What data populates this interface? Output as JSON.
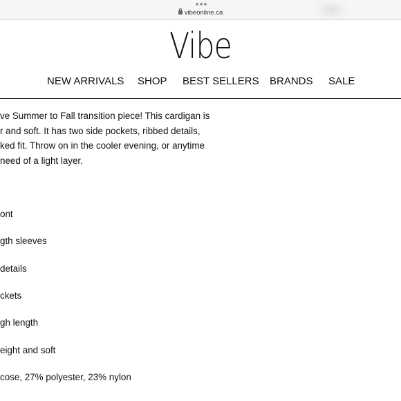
{
  "browser": {
    "url": "vibeonline.ca"
  },
  "brand": {
    "logo_text": "Vibe"
  },
  "nav": {
    "items": [
      {
        "label": "NEW ARRIVALS"
      },
      {
        "label": "SHOP"
      },
      {
        "label": "BEST SELLERS"
      },
      {
        "label": "BRANDS"
      },
      {
        "label": "SALE"
      }
    ]
  },
  "product": {
    "description_lines": [
      "ve Summer to Fall transition piece! This cardigan is",
      "r and soft. It has two side pockets, ribbed details,",
      "ked fit. Throw on in the cooler evening, or anytime",
      "need of a light layer."
    ],
    "features": [
      "ont",
      "gth sleeves",
      " details",
      "ckets",
      "gh length",
      "eight and soft",
      "cose, 27% polyester, 23% nylon"
    ]
  }
}
